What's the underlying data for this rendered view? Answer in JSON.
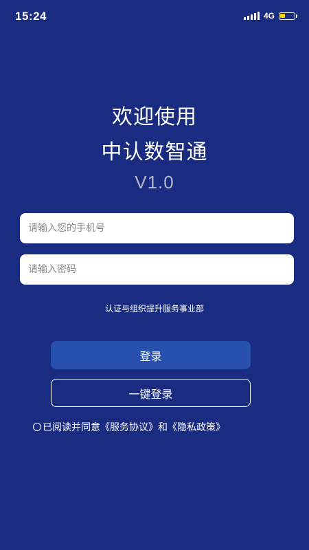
{
  "status_bar": {
    "time": "15:24",
    "network": "4G",
    "battery_level": 0.35,
    "signal_icon": "signal-bars-icon",
    "battery_icon": "battery-icon"
  },
  "welcome": {
    "line1": "欢迎使用",
    "line2": "中认数智通",
    "version": "V1.0"
  },
  "form": {
    "phone_placeholder": "请输入您的手机号",
    "password_placeholder": "请输入密码"
  },
  "org_text": "认证与组织提升服务事业部",
  "buttons": {
    "login": "登录",
    "one_key_login": "一键登录"
  },
  "agreement": {
    "prefix": "已阅读并同意",
    "service_link": "《服务协议》",
    "conjunction": "和",
    "privacy_link": "《隐私政策》",
    "checked": false
  },
  "colors": {
    "background": "#1a2b82",
    "login_button": "#2851ad",
    "version_text": "#b3b8cc",
    "battery_fill": "#f5d300"
  }
}
